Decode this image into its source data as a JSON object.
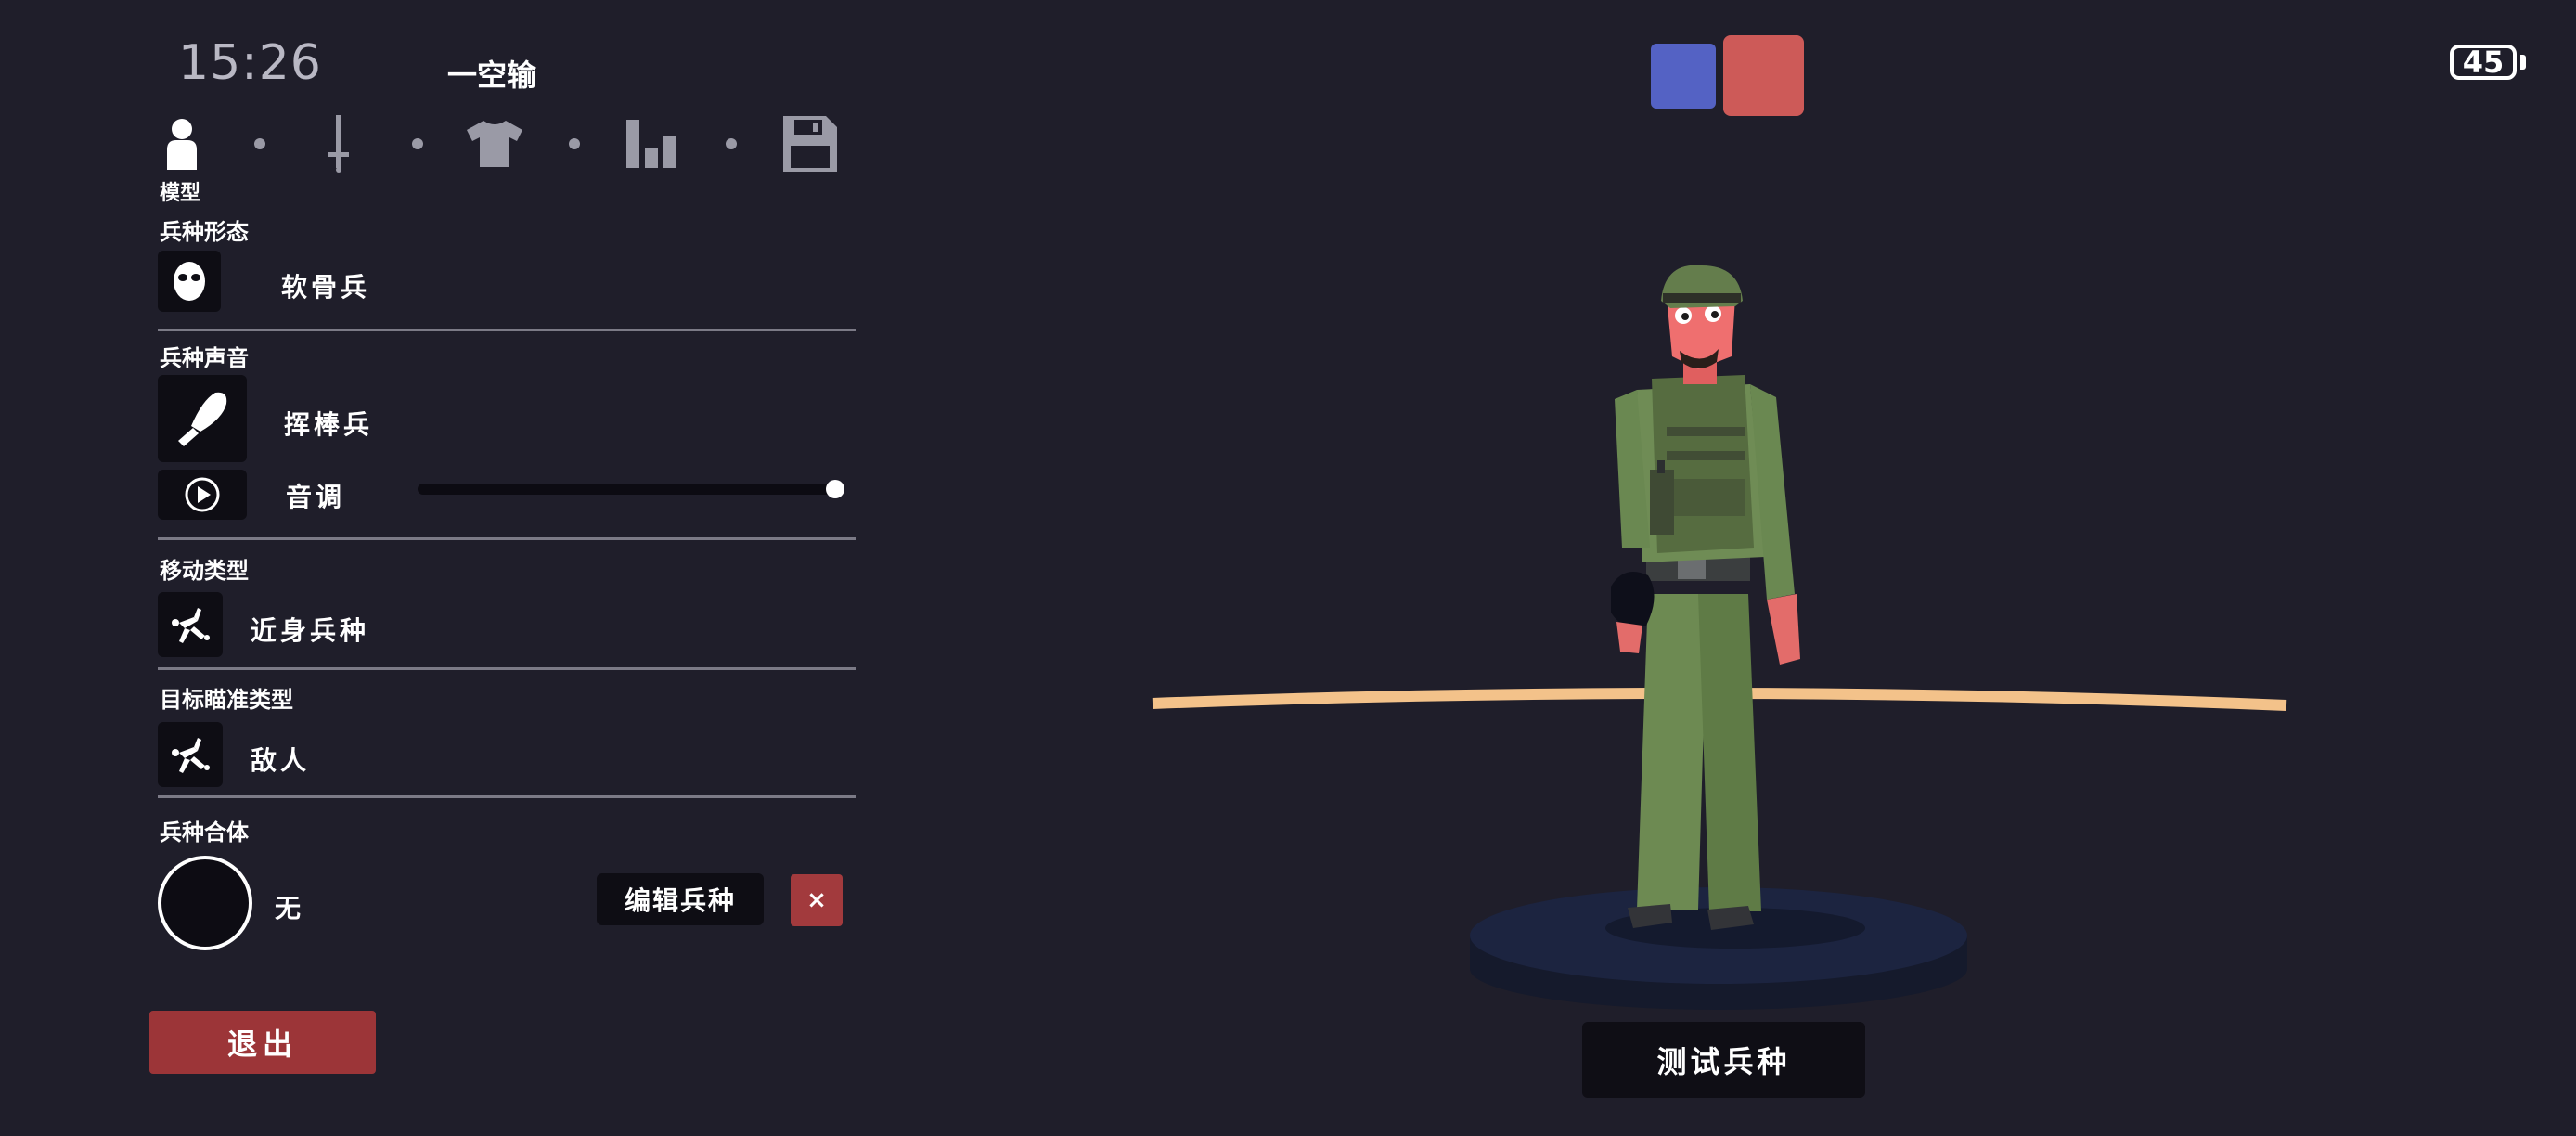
{
  "status": {
    "clock": "15:26",
    "battery": "45"
  },
  "unit_title": "一空输",
  "tabs": [
    {
      "name": "model",
      "icon": "person-icon",
      "active": true
    },
    {
      "name": "weapon",
      "icon": "sword-icon",
      "active": false
    },
    {
      "name": "clothing",
      "icon": "shirt-icon",
      "active": false
    },
    {
      "name": "stats",
      "icon": "bar-chart-icon",
      "active": false
    },
    {
      "name": "save",
      "icon": "save-icon",
      "active": false
    }
  ],
  "active_tab_label": "模型",
  "sections": {
    "form": {
      "label": "兵种形态",
      "value": "软骨兵",
      "icon": "mask-icon"
    },
    "voice": {
      "label": "兵种声音",
      "value": "挥棒兵",
      "icon": "club-icon",
      "pitch_label": "音调",
      "pitch_value": 1.0
    },
    "movement": {
      "label": "移动类型",
      "value": "近身兵种",
      "icon": "unit-move-icon"
    },
    "targeting": {
      "label": "目标瞄准类型",
      "value": "敌人",
      "icon": "unit-target-icon"
    },
    "fusion": {
      "label": "兵种合体",
      "value": "无"
    }
  },
  "buttons": {
    "edit_unit": "编辑兵种",
    "close": "×",
    "exit": "退出",
    "test_unit": "测试兵种"
  },
  "colors": {
    "team_blue": "#5462c4",
    "team_red": "#cd5a58",
    "accent_red": "#9c3538",
    "background": "#1f1e2a"
  }
}
